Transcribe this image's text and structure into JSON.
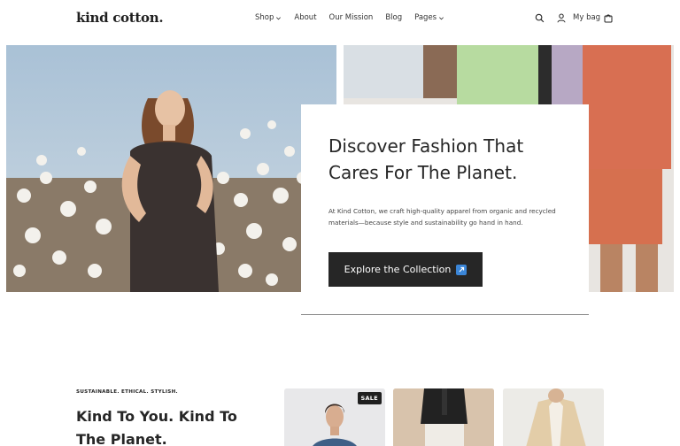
{
  "header": {
    "logo": "kind cotton.",
    "nav": [
      "Shop",
      "About",
      "Our Mission",
      "Blog",
      "Pages"
    ],
    "bag_label": "My bag"
  },
  "hero": {
    "title": "Discover Fashion That Cares For The Planet.",
    "description": "At Kind Cotton, we craft high-quality apparel from organic and recycled materials—because style and sustainability go hand in hand.",
    "cta": "Explore the Collection"
  },
  "section": {
    "kicker": "SUSTAINABLE. ETHICAL. STYLISH.",
    "title": "Kind To You. Kind To The Planet.",
    "badge": "SALE"
  },
  "icons": [
    "chevron-down-icon",
    "search-icon",
    "account-icon",
    "bag-icon",
    "external-link-icon"
  ]
}
